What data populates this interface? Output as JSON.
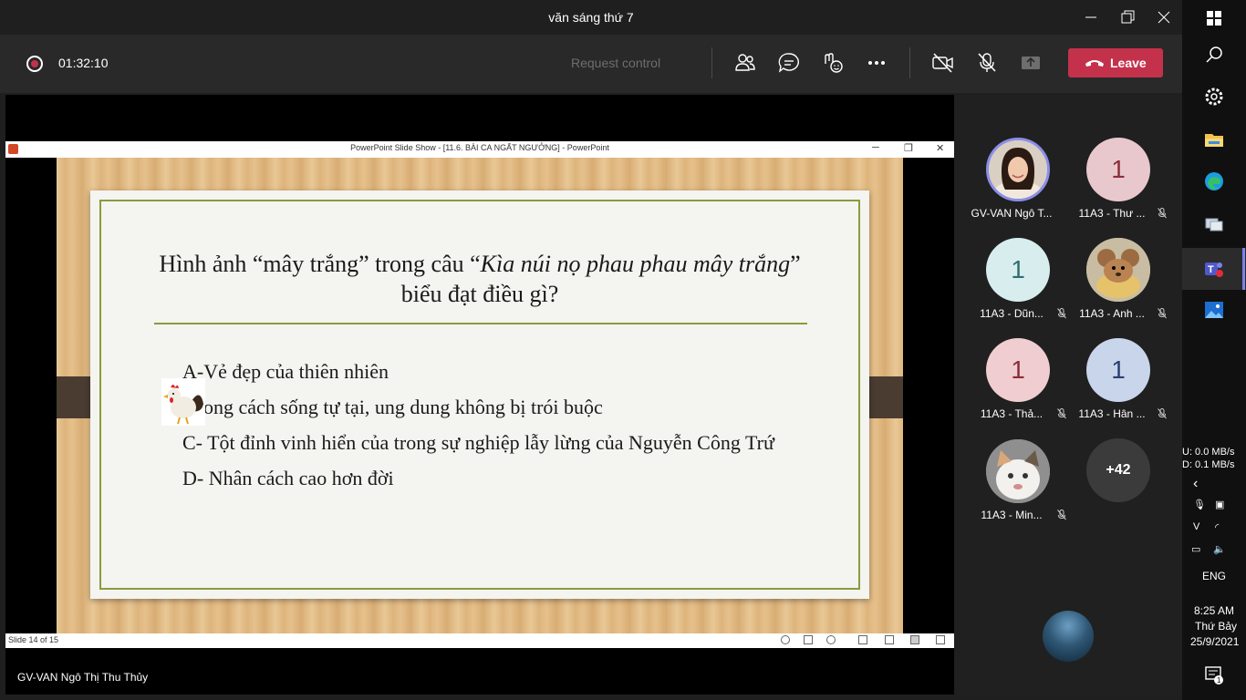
{
  "window": {
    "title": "văn sáng thứ 7",
    "minimize_icon": "minimize-icon",
    "restore_icon": "restore-icon",
    "close_icon": "close-icon"
  },
  "toolbar": {
    "timer": "01:32:10",
    "request_control": "Request control",
    "leave_label": "Leave",
    "icons": [
      "people-icon",
      "chat-icon",
      "reactions-icon",
      "more-icon",
      "camera-off-icon",
      "mic-off-icon",
      "share-icon"
    ],
    "accent": "#c4314b"
  },
  "powerpoint": {
    "title": "PowerPoint Slide Show - [11.6. BÀI CA NGẤT NGƯỞNG] - PowerPoint",
    "status": "Slide 14 of 15"
  },
  "slide": {
    "question_line1_pre": "Hình ảnh “mây trắng” trong câu “",
    "question_line1_italic": "Kìa núi nọ phau phau mây trắng",
    "question_line1_post": "”",
    "question_line2": "biểu đạt điều gì?",
    "answers": [
      "A-Vẻ đẹp của thiên nhiên",
      "B- Phong cách sống tự tại, ung dung không bị trói buộc",
      "C- Tột đỉnh vinh hiển của trong sự nghiệp lẫy lừng của Nguyễn Công Trứ",
      "D- Nhân cách cao hơn đời"
    ],
    "answer_b_visible": "ong cách sống tự tại, ung dung không bị trói buộc"
  },
  "presenter": "GV-VAN Ngô Thị Thu Thủy",
  "participants": [
    {
      "name": "GV-VAN Ngô T...",
      "avatar": "photo",
      "muted": false
    },
    {
      "name": "11A3 - Thư ...",
      "avatar": "1",
      "color": "#e8c8cc",
      "text_color": "#8a2e3b",
      "muted": true
    },
    {
      "name": "11A3 - Dũn...",
      "avatar": "1",
      "color": "#d8eeee",
      "text_color": "#2f6d70",
      "muted": true
    },
    {
      "name": "11A3 - Anh ...",
      "avatar": "cartoon",
      "muted": true
    },
    {
      "name": "11A3 - Thả...",
      "avatar": "1",
      "color": "#f0cdd0",
      "text_color": "#8a2e3b",
      "muted": true
    },
    {
      "name": "11A3 - Hân ...",
      "avatar": "1",
      "color": "#c9d5ea",
      "text_color": "#2a3f72",
      "muted": true
    },
    {
      "name": "11A3 - Min...",
      "avatar": "cat",
      "muted": true
    },
    {
      "name": "",
      "avatar": "+42",
      "color": "#3b3b3b",
      "text_color": "#ffffff",
      "muted": false
    }
  ],
  "taskbar": {
    "icons": [
      "windows-icon",
      "search-icon",
      "settings-icon",
      "file-explorer-icon",
      "edge-icon",
      "network-icon",
      "teams-icon",
      "photos-icon"
    ],
    "net_up": "U:   0.0 MB/s",
    "net_down": "D:   0.1 MB/s",
    "lang": "ENG",
    "time": "8:25 AM",
    "day": "Thứ Bảy",
    "date": "25/9/2021",
    "notif_count": "1"
  }
}
